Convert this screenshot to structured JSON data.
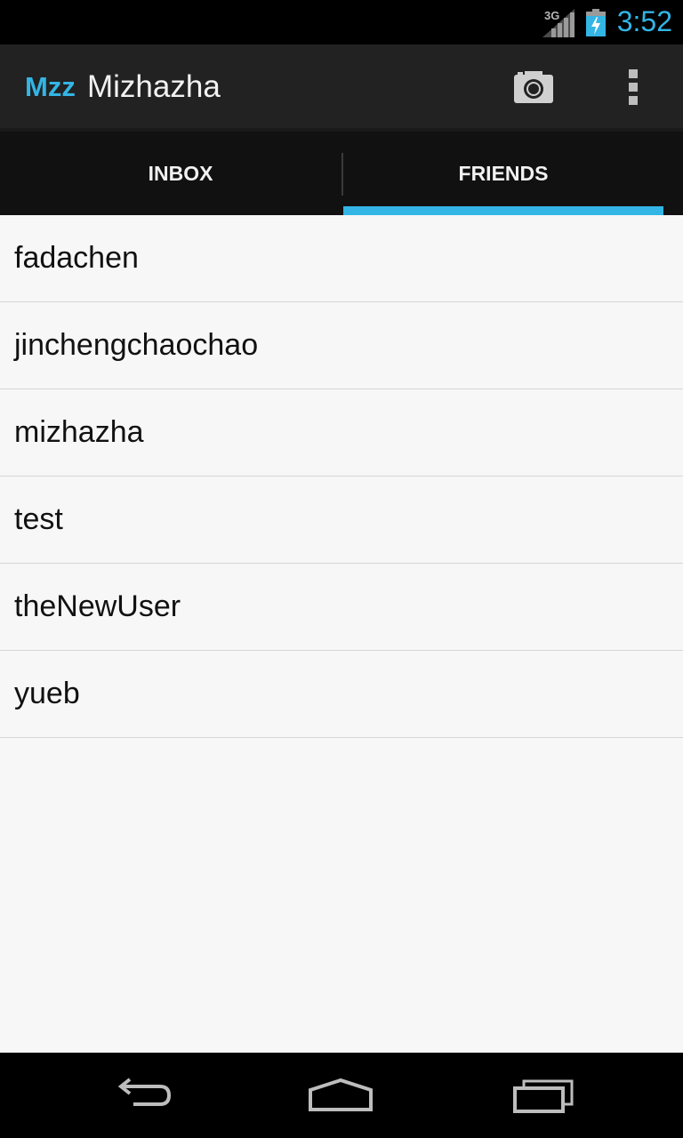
{
  "status_bar": {
    "network_label": "3G",
    "time": "3:52",
    "icons": [
      "signal-icon",
      "battery-charging-icon"
    ]
  },
  "action_bar": {
    "logo": "Mzz",
    "title": "Mizhazha",
    "actions": [
      "camera-icon",
      "overflow-menu-icon"
    ]
  },
  "tabs": [
    {
      "label": "INBOX",
      "selected": false
    },
    {
      "label": "FRIENDS",
      "selected": true
    }
  ],
  "friends": [
    {
      "name": "fadachen"
    },
    {
      "name": "jinchengchaochao"
    },
    {
      "name": "mizhazha"
    },
    {
      "name": "test"
    },
    {
      "name": "theNewUser"
    },
    {
      "name": "yueb"
    }
  ],
  "nav_bar": [
    "back-icon",
    "home-icon",
    "recent-apps-icon"
  ],
  "colors": {
    "accent": "#33b5e5",
    "action_bar": "#222222",
    "tab_bar": "#111111",
    "list_background": "#f7f7f7"
  }
}
